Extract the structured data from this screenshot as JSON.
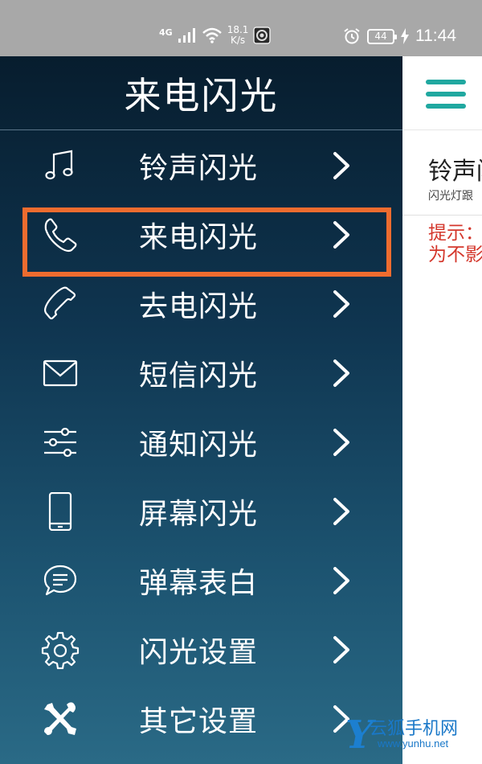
{
  "status_bar": {
    "network": "4G",
    "speed_value": "18.1",
    "speed_unit": "K/s",
    "battery": "44",
    "time": "11:44"
  },
  "drawer": {
    "title": "来电闪光",
    "items": [
      {
        "label": "铃声闪光",
        "icon": "music-note-icon"
      },
      {
        "label": "来电闪光",
        "icon": "phone-icon"
      },
      {
        "label": "去电闪光",
        "icon": "phone-outgoing-icon"
      },
      {
        "label": "短信闪光",
        "icon": "envelope-icon"
      },
      {
        "label": "通知闪光",
        "icon": "sliders-icon"
      },
      {
        "label": "屏幕闪光",
        "icon": "smartphone-icon"
      },
      {
        "label": "弹幕表白",
        "icon": "chat-bubble-icon"
      },
      {
        "label": "闪光设置",
        "icon": "gear-icon"
      },
      {
        "label": "其它设置",
        "icon": "tools-icon"
      }
    ],
    "highlighted_index": 1,
    "highlight_color": "#ee6c2f"
  },
  "background_page": {
    "title": "铃声闪",
    "subtitle": "闪光灯跟",
    "tip_line1": "提示：",
    "tip_line2": "为不影",
    "accent_color": "#20a8a0",
    "tip_color": "#d4372c"
  },
  "watermark": {
    "title": "云狐手机网",
    "url": "www.yunhu.net"
  }
}
